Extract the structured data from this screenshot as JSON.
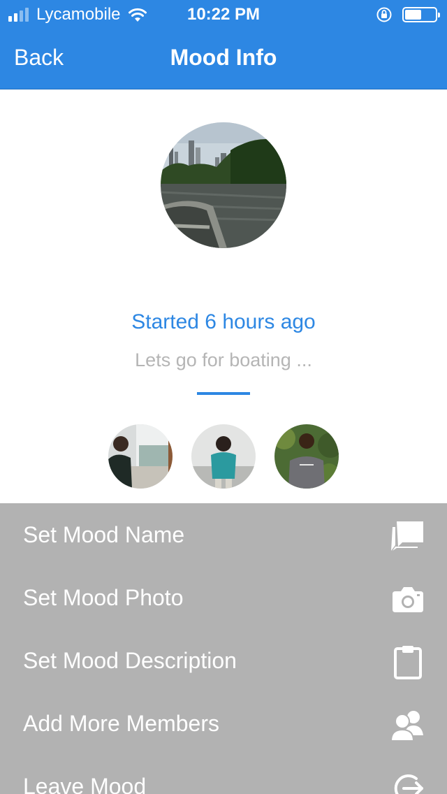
{
  "status_bar": {
    "carrier": "Lycamobile",
    "time": "10:22 PM",
    "signal_bars": 4,
    "signal_bars_filled": 2,
    "battery_level": 0.55
  },
  "nav": {
    "back_label": "Back",
    "title": "Mood Info"
  },
  "mood": {
    "started": "Started 6 hours ago",
    "description": "Lets go for boating ..."
  },
  "members": [
    "member-1",
    "member-2",
    "member-3"
  ],
  "menu": {
    "items": [
      {
        "label": "Set Mood Name",
        "icon": "chat-bubble-icon"
      },
      {
        "label": "Set Mood Photo",
        "icon": "camera-icon"
      },
      {
        "label": "Set Mood Description",
        "icon": "clipboard-icon"
      },
      {
        "label": "Add More Members",
        "icon": "add-members-icon"
      },
      {
        "label": "Leave Mood",
        "icon": "leave-icon"
      }
    ]
  },
  "colors": {
    "accent": "#2d87e3",
    "menu_background": "#b2b2b2",
    "description_text": "#b5b5b5"
  }
}
